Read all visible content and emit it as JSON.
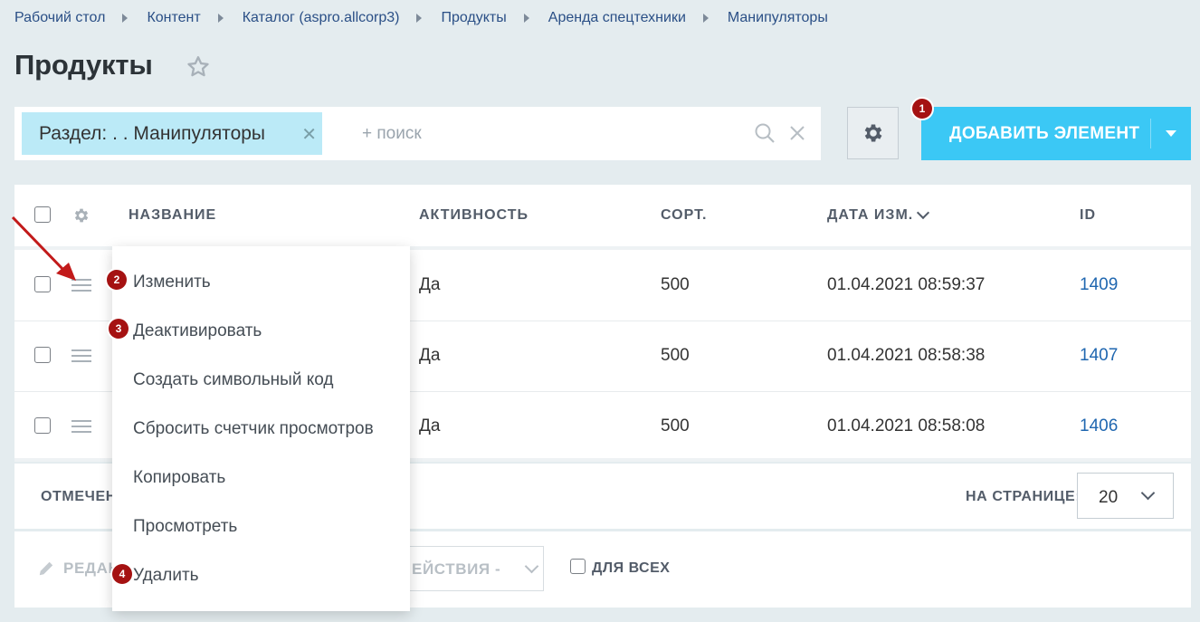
{
  "breadcrumb": [
    "Рабочий стол",
    "Контент",
    "Каталог (aspro.allcorp3)",
    "Продукты",
    "Аренда спецтехники",
    "Манипуляторы"
  ],
  "page_title": "Продукты",
  "filter": {
    "tag_label": "Раздел: . . Манипуляторы",
    "search_placeholder": "+ поиск"
  },
  "toolbar": {
    "add_label": "ДОБАВИТЬ ЭЛЕМЕНТ"
  },
  "badges": [
    "1",
    "2",
    "3",
    "4"
  ],
  "grid": {
    "columns": [
      "НАЗВАНИЕ",
      "АКТИВНОСТЬ",
      "СОРТ.",
      "ДАТА ИЗМ.",
      "ID"
    ],
    "rows": [
      {
        "active": "Да",
        "sort": "500",
        "date": "01.04.2021 08:59:37",
        "id": "1409"
      },
      {
        "active": "Да",
        "sort": "500",
        "date": "01.04.2021 08:58:38",
        "id": "1407"
      },
      {
        "active": "Да",
        "sort": "500",
        "date": "01.04.2021 08:58:08",
        "id": "1406"
      }
    ]
  },
  "footer": {
    "selected_label": "ОТМЕЧЕН",
    "per_page_label": "НА СТРАНИЦЕ:",
    "per_page_value": "20"
  },
  "actions": {
    "edit_label": "РЕДАК",
    "actions_select_label": "ЕЙСТВИЯ -",
    "for_all_label": "ДЛЯ ВСЕХ"
  },
  "context_menu": {
    "items": [
      "Изменить",
      "Деактивировать",
      "Создать символьный код",
      "Сбросить счетчик просмотров",
      "Копировать",
      "Просмотреть",
      "Удалить"
    ]
  },
  "colors": {
    "accent": "#3bc8f5",
    "badge": "#a51212",
    "link": "#2067b0",
    "background": "#e4ecef"
  }
}
